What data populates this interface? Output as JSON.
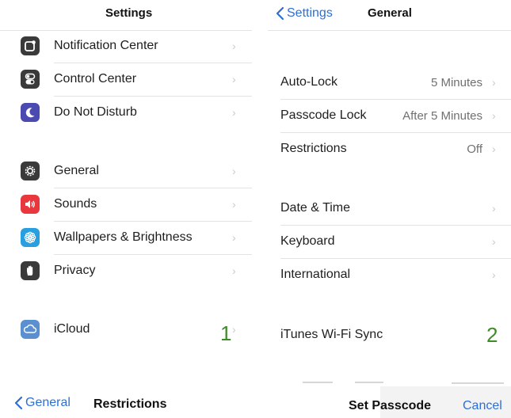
{
  "left_panel": {
    "title": "Settings",
    "groups": [
      [
        {
          "label": "Notification Center",
          "icon": "notification-center-icon",
          "icon_color": "#3a3a3a"
        },
        {
          "label": "Control Center",
          "icon": "control-center-icon",
          "icon_color": "#3a3a3a"
        },
        {
          "label": "Do Not Disturb",
          "icon": "moon-icon",
          "icon_color": "#4a4ab0"
        }
      ],
      [
        {
          "label": "General",
          "icon": "gear-icon",
          "icon_color": "#3a3a3a"
        },
        {
          "label": "Sounds",
          "icon": "speaker-icon",
          "icon_color": "#e8383d"
        },
        {
          "label": "Wallpapers & Brightness",
          "icon": "flower-icon",
          "icon_color": "#2a9fe0"
        },
        {
          "label": "Privacy",
          "icon": "hand-icon",
          "icon_color": "#3a3a3a"
        }
      ],
      [
        {
          "label": "iCloud",
          "icon": "cloud-icon",
          "icon_color": "#5a8fd0"
        }
      ]
    ],
    "annotation": "1",
    "bottom_nav": {
      "back_label": "General",
      "title": "Restrictions"
    }
  },
  "right_panel": {
    "back_label": "Settings",
    "title": "General",
    "rows": [
      {
        "label": "Auto-Lock",
        "value": "5 Minutes"
      },
      {
        "label": "Passcode Lock",
        "value": "After 5 Minutes"
      },
      {
        "label": "Restrictions",
        "value": "Off"
      },
      {
        "label": "Date & Time",
        "value": ""
      },
      {
        "label": "Keyboard",
        "value": ""
      },
      {
        "label": "International",
        "value": ""
      },
      {
        "label": "iTunes Wi-Fi Sync",
        "value": ""
      }
    ],
    "annotation": "2",
    "bottom_bar": {
      "title": "Set Passcode",
      "cancel_label": "Cancel"
    }
  },
  "colors": {
    "accent": "#2d6fd6",
    "annotation": "#3f8a2a"
  }
}
